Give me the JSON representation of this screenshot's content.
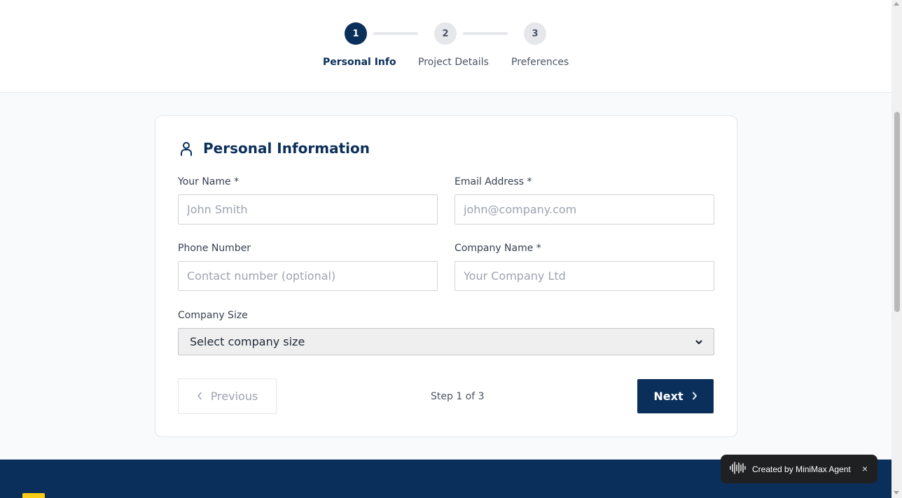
{
  "stepper": {
    "steps": [
      {
        "number": "1",
        "label": "Personal Info",
        "state": "active"
      },
      {
        "number": "2",
        "label": "Project Details",
        "state": "inactive"
      },
      {
        "number": "3",
        "label": "Preferences",
        "state": "inactive"
      }
    ]
  },
  "card": {
    "icon": "user-icon",
    "title": "Personal Information",
    "fields": {
      "name": {
        "label": "Your Name *",
        "placeholder": "John Smith",
        "value": ""
      },
      "email": {
        "label": "Email Address *",
        "placeholder": "john@company.com",
        "value": ""
      },
      "phone": {
        "label": "Phone Number",
        "placeholder": "Contact number (optional)",
        "value": ""
      },
      "company": {
        "label": "Company Name *",
        "placeholder": "Your Company Ltd",
        "value": ""
      },
      "company_size": {
        "label": "Company Size",
        "selected": "Select company size"
      }
    },
    "nav": {
      "previous_label": "Previous",
      "step_text": "Step 1 of 3",
      "next_label": "Next"
    }
  },
  "badge": {
    "icon": "waveform-icon",
    "text": "Created by MiniMax Agent",
    "close": "×"
  },
  "colors": {
    "primary": "#0b2f5b",
    "accent": "#facc15",
    "inactive_step": "#e5e7eb"
  }
}
